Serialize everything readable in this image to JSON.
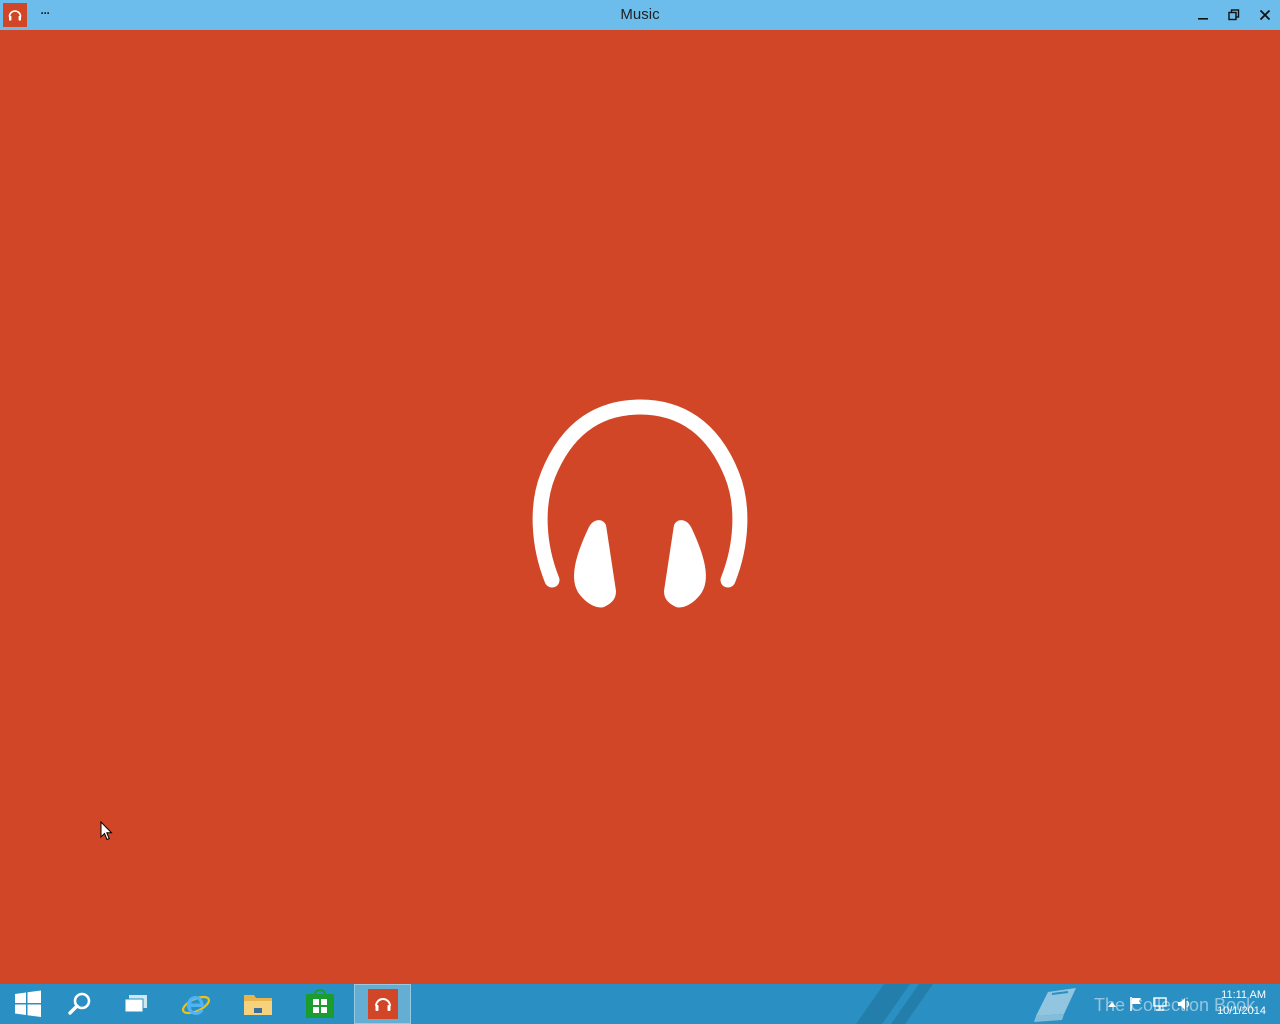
{
  "window": {
    "title": "Music",
    "more_label": "···",
    "app_icon": "headphones-icon",
    "controls": [
      "minimize-icon",
      "restore-icon",
      "close-icon"
    ]
  },
  "splash": {
    "icon": "headphones-icon"
  },
  "colors": {
    "accent": "#d14626",
    "titlebar": "#6dbdec",
    "taskbar": "#2a8fc2",
    "store": "#1a9d2e"
  },
  "taskbar": {
    "items": [
      {
        "name": "start",
        "icon": "windows-logo-icon"
      },
      {
        "name": "search",
        "icon": "search-icon"
      },
      {
        "name": "task-view",
        "icon": "task-view-icon"
      },
      {
        "name": "internet-explorer",
        "icon": "internet-explorer-icon"
      },
      {
        "name": "file-explorer",
        "icon": "folder-icon"
      },
      {
        "name": "store",
        "icon": "store-bag-icon"
      },
      {
        "name": "music",
        "icon": "headphones-icon",
        "active": true
      }
    ],
    "watermark": "The Collection Book",
    "tray_icons": [
      "show-hidden-icons-chevron",
      "action-center-flag-icon",
      "network-icon",
      "volume-icon"
    ],
    "clock": {
      "time": "11:11 AM",
      "date": "10/1/2014"
    }
  }
}
